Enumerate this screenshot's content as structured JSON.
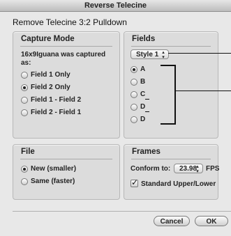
{
  "window": {
    "title": "Reverse Telecine"
  },
  "dialog": {
    "heading": "Remove Telecine 3:2 Pulldown"
  },
  "capture_mode": {
    "title": "Capture Mode",
    "description": "16x9Iguana was captured as:",
    "options": [
      {
        "label": "Field 1 Only",
        "selected": false
      },
      {
        "label": "Field 2 Only",
        "selected": true
      },
      {
        "label": "Field 1 - Field 2",
        "selected": false
      },
      {
        "label": "Field 2 - Field 1",
        "selected": false
      }
    ]
  },
  "fields": {
    "title": "Fields",
    "style_popup": "Style 1",
    "options": [
      {
        "label": "A",
        "selected": true
      },
      {
        "label": "B",
        "selected": false
      },
      {
        "label": "C",
        "selected": false
      },
      {
        "label": "D",
        "selected": false
      },
      {
        "label": "D",
        "selected": false
      }
    ]
  },
  "file": {
    "title": "File",
    "options": [
      {
        "label": "New (smaller)",
        "selected": true
      },
      {
        "label": "Same (faster)",
        "selected": false
      }
    ]
  },
  "frames": {
    "title": "Frames",
    "conform_label": "Conform to:",
    "conform_value": "23.98",
    "fps_label": "FPS",
    "standard_label": "Standard Upper/Lower",
    "standard_checked": true
  },
  "buttons": {
    "cancel": "Cancel",
    "ok": "OK"
  },
  "icons": {
    "popup_arrows": "updown-arrows-icon",
    "check": "checkmark-icon"
  }
}
